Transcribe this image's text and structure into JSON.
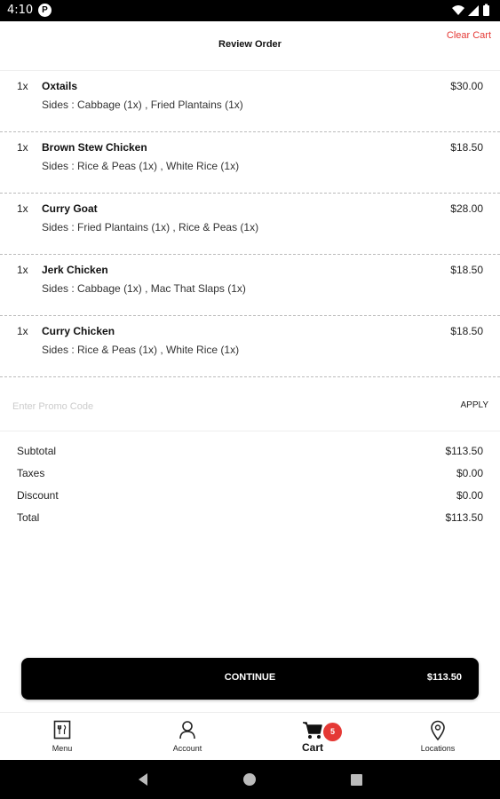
{
  "status_bar": {
    "time": "4:10",
    "app_indicator": "P"
  },
  "header": {
    "title": "Review Order",
    "clear_cart_label": "Clear Cart"
  },
  "order_items": [
    {
      "qty": "1x",
      "name": "Oxtails",
      "sides": "Sides : Cabbage (1x) , Fried Plantains (1x)",
      "price": "$30.00"
    },
    {
      "qty": "1x",
      "name": "Brown Stew Chicken",
      "sides": "Sides : Rice & Peas (1x) , White Rice (1x)",
      "price": "$18.50"
    },
    {
      "qty": "1x",
      "name": "Curry Goat",
      "sides": "Sides : Fried Plantains (1x) , Rice & Peas (1x)",
      "price": "$28.00"
    },
    {
      "qty": "1x",
      "name": "Jerk Chicken",
      "sides": "Sides : Cabbage (1x) , Mac That Slaps (1x)",
      "price": "$18.50"
    },
    {
      "qty": "1x",
      "name": "Curry Chicken",
      "sides": "Sides : Rice & Peas (1x) , White Rice (1x)",
      "price": "$18.50"
    }
  ],
  "promo": {
    "placeholder": "Enter Promo Code",
    "value": "",
    "apply_label": "APPLY"
  },
  "summary": [
    {
      "label": "Subtotal",
      "value": "$113.50"
    },
    {
      "label": "Taxes",
      "value": "$0.00"
    },
    {
      "label": "Discount",
      "value": "$0.00"
    },
    {
      "label": "Total",
      "value": "$113.50"
    }
  ],
  "continue_button": {
    "label": "CONTINUE",
    "price": "$113.50"
  },
  "bottom_nav": {
    "items": [
      {
        "label": "Menu",
        "icon": "menu-book-icon"
      },
      {
        "label": "Account",
        "icon": "person-icon"
      },
      {
        "label": "Cart",
        "icon": "cart-icon",
        "active": true,
        "badge": "5"
      },
      {
        "label": "Locations",
        "icon": "location-pin-icon"
      }
    ]
  },
  "colors": {
    "accent": "#e53935",
    "primary": "#000000"
  }
}
